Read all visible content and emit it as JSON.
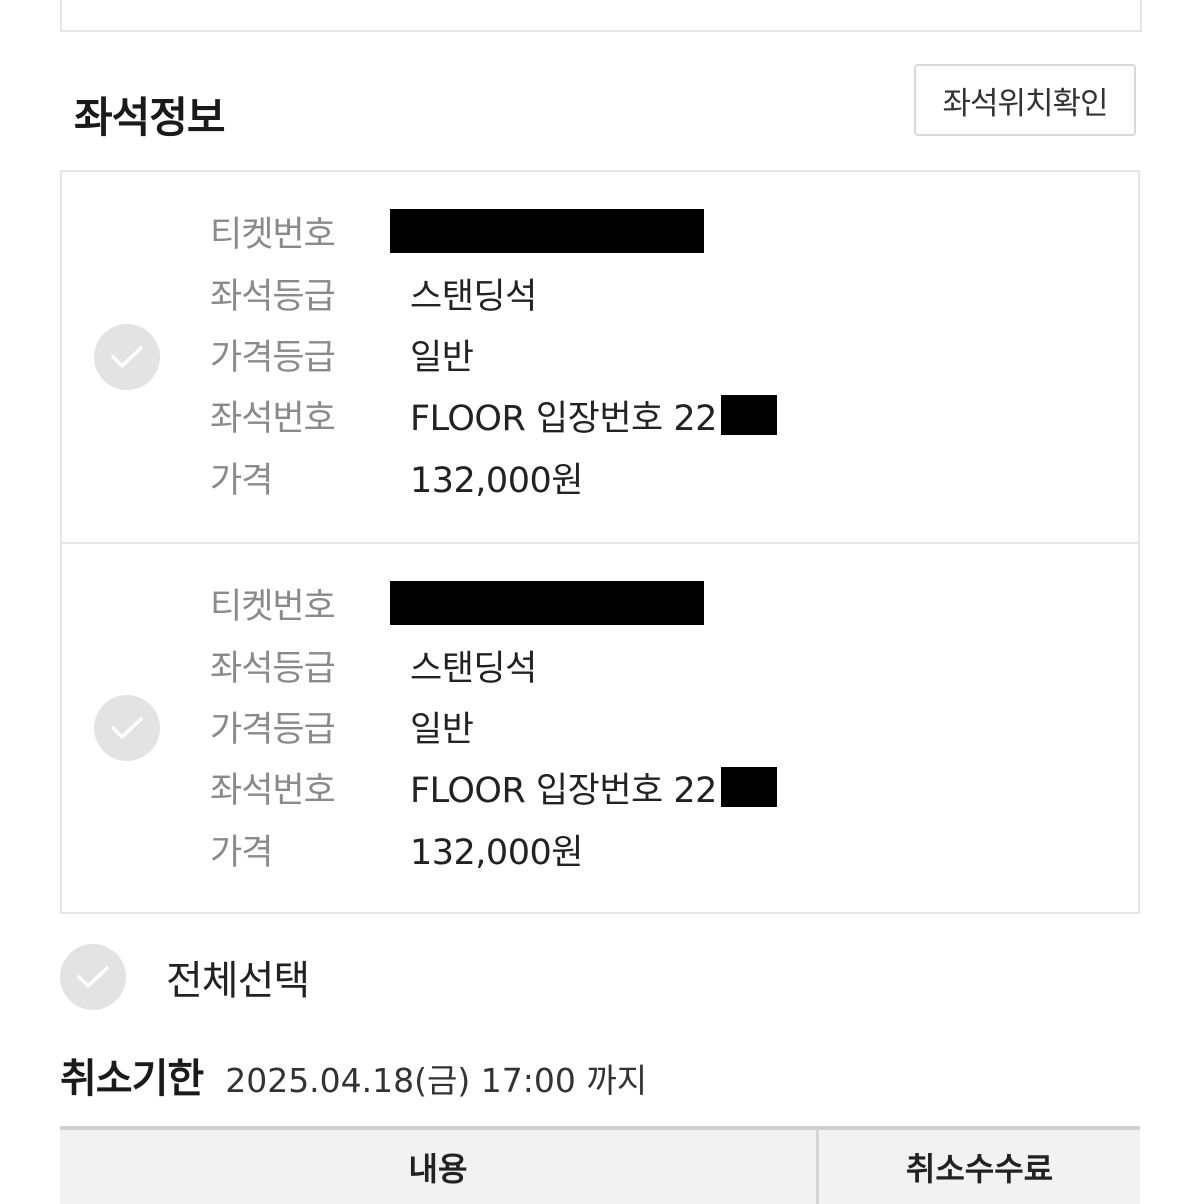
{
  "section": {
    "title": "좌석정보",
    "seat_location_button": "좌석위치확인"
  },
  "tickets": [
    {
      "ticket_number_label": "티켓번호",
      "seat_grade_label": "좌석등급",
      "seat_grade": "스탠딩석",
      "price_grade_label": "가격등급",
      "price_grade": "일반",
      "seat_number_label": "좌석번호",
      "seat_number": "FLOOR 입장번호 22",
      "price_label": "가격",
      "price": "132,000원"
    },
    {
      "ticket_number_label": "티켓번호",
      "seat_grade_label": "좌석등급",
      "seat_grade": "스탠딩석",
      "price_grade_label": "가격등급",
      "price_grade": "일반",
      "seat_number_label": "좌석번호",
      "seat_number": "FLOOR 입장번호 22",
      "price_label": "가격",
      "price": "132,000원"
    }
  ],
  "select_all": {
    "label": "전체선택"
  },
  "cancel_deadline": {
    "label": "취소기한",
    "value": "2025.04.18(금) 17:00 까지"
  },
  "fee_table": {
    "headers": [
      "내용",
      "취소수수료"
    ]
  },
  "icons": {
    "check": "check-icon"
  },
  "colors": {
    "check_bg": "#e3e3e3",
    "redaction": "#000000",
    "label_gray": "#8a8a8a"
  }
}
